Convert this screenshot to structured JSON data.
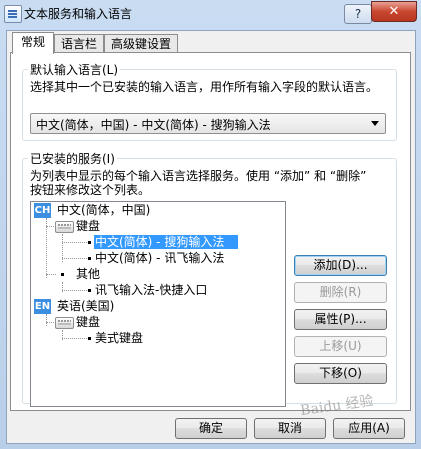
{
  "window": {
    "title": "文本服务和输入语言",
    "help_label": "?",
    "close_label": "✕",
    "icon": "keyboard-settings-icon"
  },
  "tabs": [
    {
      "label": "常规",
      "active": true
    },
    {
      "label": "语言栏",
      "active": false
    },
    {
      "label": "高级键设置",
      "active": false
    }
  ],
  "default_language": {
    "group_label": "默认输入语言(L)",
    "description": "选择其中一个已安装的输入语言，用作所有输入字段的默认语言。",
    "selected": "中文(简体，中国) - 中文(简体) - 搜狗输入法"
  },
  "installed_services": {
    "group_label": "已安装的服务(I)",
    "description_line1": "为列表中显示的每个输入语言选择服务。使用 “添加” 和 “删除”",
    "description_line2": "按钮来修改这个列表。",
    "tree": {
      "lang1_badge": "CH",
      "lang1_label": "中文(简体，中国)",
      "lang1_keyboard_label": "键盘",
      "lang1_kb_item1": "中文(简体) - 搜狗输入法",
      "lang1_kb_item2": "中文(简体) - 讯飞输入法",
      "lang1_other_label": "其他",
      "lang1_other_item1": "讯飞输入法-快捷入口",
      "lang2_badge": "EN",
      "lang2_label": "英语(美国)",
      "lang2_keyboard_label": "键盘",
      "lang2_kb_item1": "美式键盘"
    },
    "buttons": {
      "add": "添加(D)...",
      "remove": "删除(R)",
      "properties": "属性(P)...",
      "move_up": "上移(U)",
      "move_down": "下移(O)"
    }
  },
  "footer": {
    "ok": "确定",
    "cancel": "取消",
    "apply": "应用(A)"
  },
  "watermark": "Baidu 经验",
  "colors": {
    "ch_badge": "#3c8fe0",
    "en_badge": "#3c8fe0",
    "selection": "#3399ff",
    "close_button": "#c9472f"
  }
}
